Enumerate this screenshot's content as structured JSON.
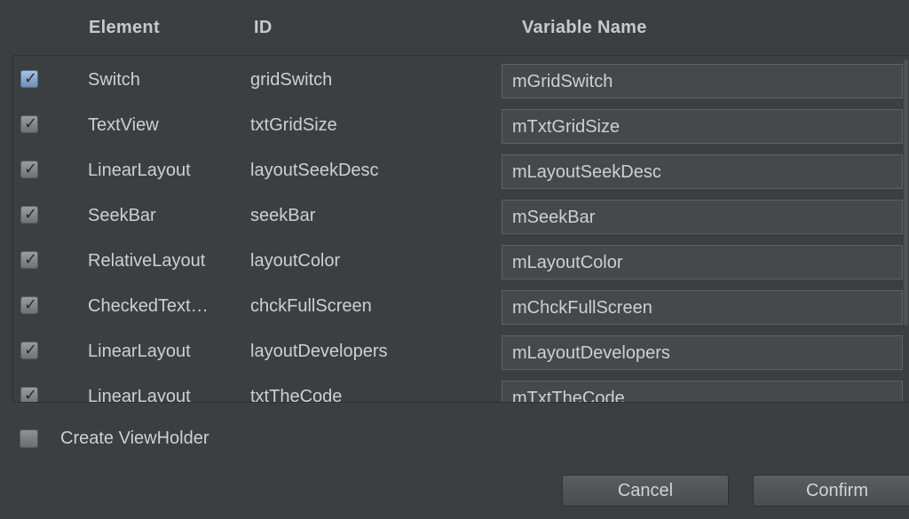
{
  "header": {
    "element": "Element",
    "id": "ID",
    "variable_name": "Variable Name"
  },
  "rows": [
    {
      "checked": true,
      "element": "Switch",
      "id": "gridSwitch",
      "variable": "mGridSwitch"
    },
    {
      "checked": true,
      "element": "TextView",
      "id": "txtGridSize",
      "variable": "mTxtGridSize"
    },
    {
      "checked": true,
      "element": "LinearLayout",
      "id": "layoutSeekDesc",
      "variable": "mLayoutSeekDesc"
    },
    {
      "checked": true,
      "element": "SeekBar",
      "id": "seekBar",
      "variable": "mSeekBar"
    },
    {
      "checked": true,
      "element": "RelativeLayout",
      "id": "layoutColor",
      "variable": "mLayoutColor"
    },
    {
      "checked": true,
      "element": "CheckedText…",
      "id": "chckFullScreen",
      "variable": "mChckFullScreen"
    },
    {
      "checked": true,
      "element": "LinearLayout",
      "id": "layoutDevelopers",
      "variable": "mLayoutDevelopers"
    },
    {
      "checked": true,
      "element": "LinearLayout",
      "id": "txtTheCode",
      "variable": "mTxtTheCode"
    }
  ],
  "viewholder": {
    "label": "Create ViewHolder",
    "checked": false
  },
  "buttons": {
    "cancel": "Cancel",
    "confirm": "Confirm"
  },
  "icons": {
    "checkbox_checked": "checkmark-icon"
  },
  "colors": {
    "background": "#3c3f41",
    "field": "#45494a",
    "text": "#cdd0d2"
  }
}
